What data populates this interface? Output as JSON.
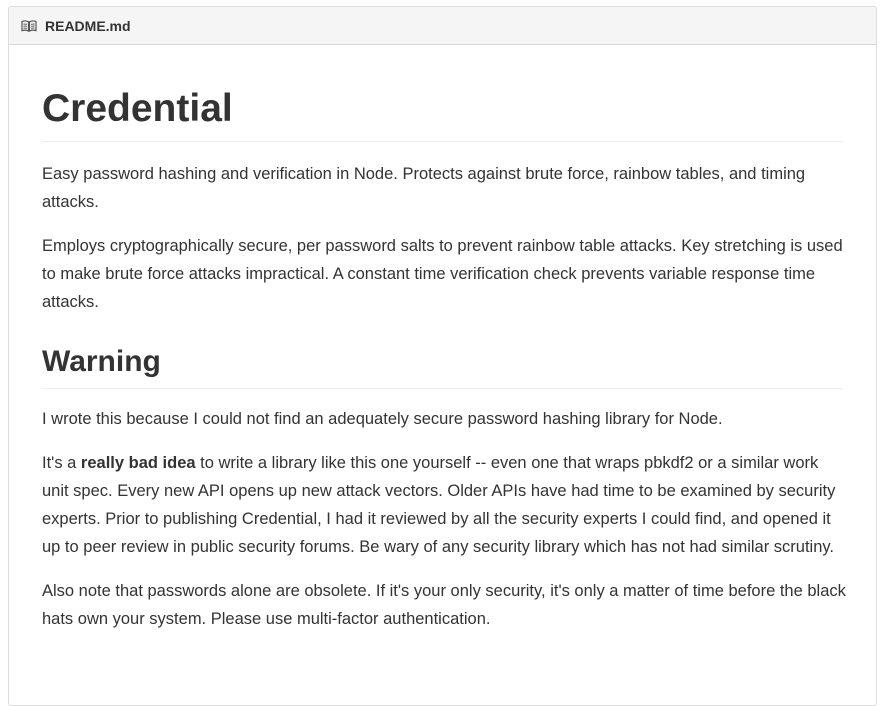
{
  "header": {
    "icon": "book-icon",
    "filename": "README.md"
  },
  "content": {
    "title": "Credential",
    "intro": [
      "Easy password hashing and verification in Node. Protects against brute force, rainbow tables, and timing attacks.",
      "Employs cryptographically secure, per password salts to prevent rainbow table attacks. Key stretching is used to make brute force attacks impractical. A constant time verification check prevents variable response time attacks."
    ],
    "warning": {
      "heading": "Warning",
      "p1": "I wrote this because I could not find an adequately secure password hashing library for Node.",
      "p2_before": "It's a ",
      "p2_bold": "really bad idea",
      "p2_after": " to write a library like this one yourself -- even one that wraps pbkdf2 or a similar work unit spec. Every new API opens up new attack vectors. Older APIs have had time to be examined by security experts. Prior to publishing Credential, I had it reviewed by all the security experts I could find, and opened it up to peer review in public security forums. Be wary of any security library which has not had similar scrutiny.",
      "p3": "Also note that passwords alone are obsolete. If it's your only security, it's only a matter of time before the black hats own your system. Please use multi-factor authentication."
    }
  },
  "colors": {
    "text": "#333333",
    "header_bg": "#f5f5f5",
    "border": "#dddddd"
  }
}
